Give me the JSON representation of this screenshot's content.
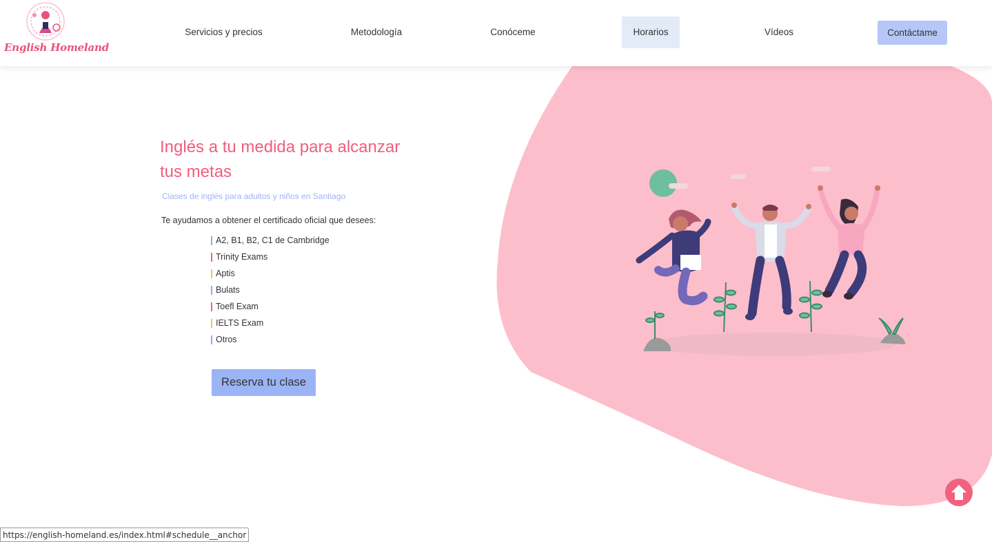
{
  "header": {
    "logo_text": "English Homeland",
    "nav": [
      {
        "label": "Servicios y precios",
        "state": "normal"
      },
      {
        "label": "Metodología",
        "state": "normal"
      },
      {
        "label": "Conóceme",
        "state": "normal"
      },
      {
        "label": "Horarios",
        "state": "hover"
      },
      {
        "label": "Vídeos",
        "state": "normal"
      },
      {
        "label": "Contáctame",
        "state": "cta"
      }
    ]
  },
  "hero": {
    "title": "Inglés a tu medida para alcanzar tus metas",
    "subtitle": "Clases de inglés para adultos y niños en Santiago",
    "intro": "Te ayudamos a obtener el certificado oficial que desees:",
    "certificates": [
      {
        "label": "A2, B1, B2, C1 de Cambridge",
        "color": "#8fa9ee"
      },
      {
        "label": "Trinity Exams",
        "color": "#f0627e"
      },
      {
        "label": "Aptis",
        "color": "#f2c14e"
      },
      {
        "label": "Bulats",
        "color": "#8fa9ee"
      },
      {
        "label": "Toefl Exam",
        "color": "#f0627e"
      },
      {
        "label": "IELTS Exam",
        "color": "#f2c14e"
      },
      {
        "label": "Otros",
        "color": "#8fa9ee"
      }
    ],
    "cta_label": "Reserva tu clase"
  },
  "scroll_top_icon": "arrow-up-circle-icon",
  "status_bar": {
    "url": "https://english-homeland.es/index.html#schedule__anchor"
  },
  "colors": {
    "brand_pink": "#ef5d7e",
    "blob_pink": "#fdbecb",
    "accent_blue": "#9bb4f6",
    "nav_hover": "#e3eaf8"
  }
}
